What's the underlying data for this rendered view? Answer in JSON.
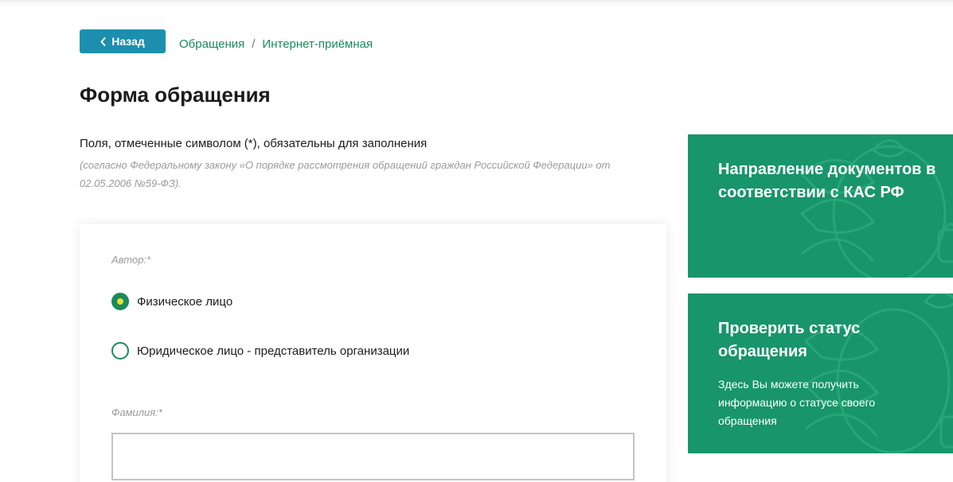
{
  "header": {
    "back_label": "Назад",
    "breadcrumb": [
      "Обращения",
      "Интернет-приёмная"
    ],
    "breadcrumb_separator": "/"
  },
  "page": {
    "title": "Форма обращения",
    "required_note": "Поля, отмеченные символом (*), обязательны для заполнения",
    "law_note": "(согласно Федеральному закону «О порядке рассмотрения обращений граждан Российской Федерации» от 02.05.2006 №59-ФЗ)."
  },
  "form": {
    "author_label": "Автор:*",
    "author_options": [
      {
        "label": "Физическое лицо",
        "selected": true
      },
      {
        "label": "Юридическое лицо - представитель организации",
        "selected": false
      }
    ],
    "surname_label": "Фамилия:*",
    "surname_value": ""
  },
  "sidebar": {
    "cards": [
      {
        "title": "Направление документов в соответствии с КАС РФ",
        "text": ""
      },
      {
        "title": "Проверить статус обращения",
        "text": "Здесь Вы можете получить информацию о статусе своего обращения"
      }
    ]
  },
  "colors": {
    "accent_green": "#18956a",
    "link_green": "#1a8a5c",
    "button_blue": "#1d8fae",
    "radio_dot": "#e8e22a"
  },
  "icons": {
    "back": "chevron-left-icon",
    "card_background": "emblem-icon"
  }
}
